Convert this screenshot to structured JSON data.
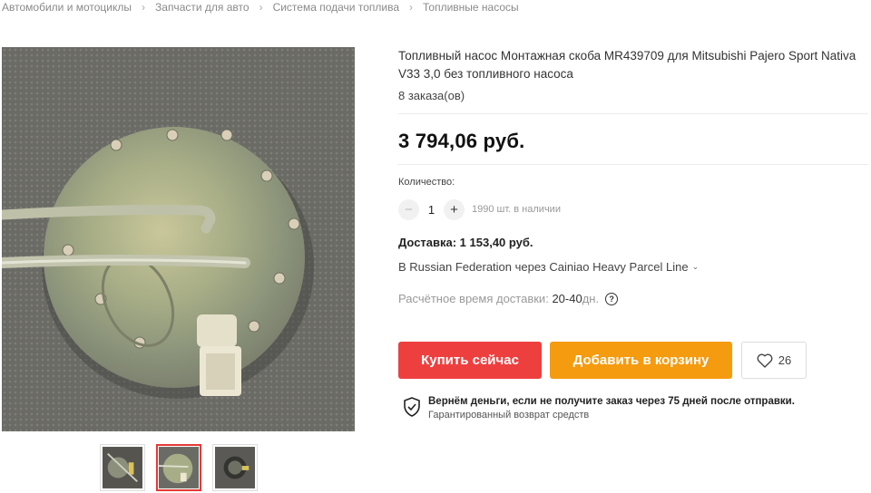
{
  "breadcrumb": [
    "Автомобили и мотоциклы",
    "Запчасти для авто",
    "Система подачи топлива",
    "Топливные насосы"
  ],
  "product": {
    "title": "Топливный насос Монтажная скоба MR439709 для Mitsubishi Pajero Sport Nativa V33 3,0 без топливного насоса",
    "orders": "8 заказа(ов)",
    "price": "3 794,06 руб."
  },
  "quantity": {
    "label": "Количество:",
    "minus": "−",
    "value": "1",
    "plus": "+",
    "stock": "1990 шт. в наличии"
  },
  "delivery": {
    "cost": "Доставка: 1 153,40 руб.",
    "route": "В Russian Federation через Cainiao Heavy Parcel Line",
    "time_label": "Расчётное время доставки: ",
    "time_value": "20-40",
    "time_suffix": "дн.",
    "help_icon": "?"
  },
  "actions": {
    "buy": "Купить сейчас",
    "cart": "Добавить в корзину",
    "wish_count": "26"
  },
  "guarantee": {
    "title": "Вернём деньги, если не получите заказ через 75 дней после отправки.",
    "subtitle": "Гарантированный возврат средств"
  },
  "icons": {
    "breadcrumb_separator": "chevron-right-icon",
    "route_dropdown": "chevron-down-icon",
    "wishlist": "heart-icon",
    "guarantee": "shield-check-icon",
    "help": "question-circle-icon"
  },
  "colors": {
    "buy_button": "#ee3f3f",
    "cart_button": "#f59b0f",
    "active_thumb_border": "#e53935"
  }
}
